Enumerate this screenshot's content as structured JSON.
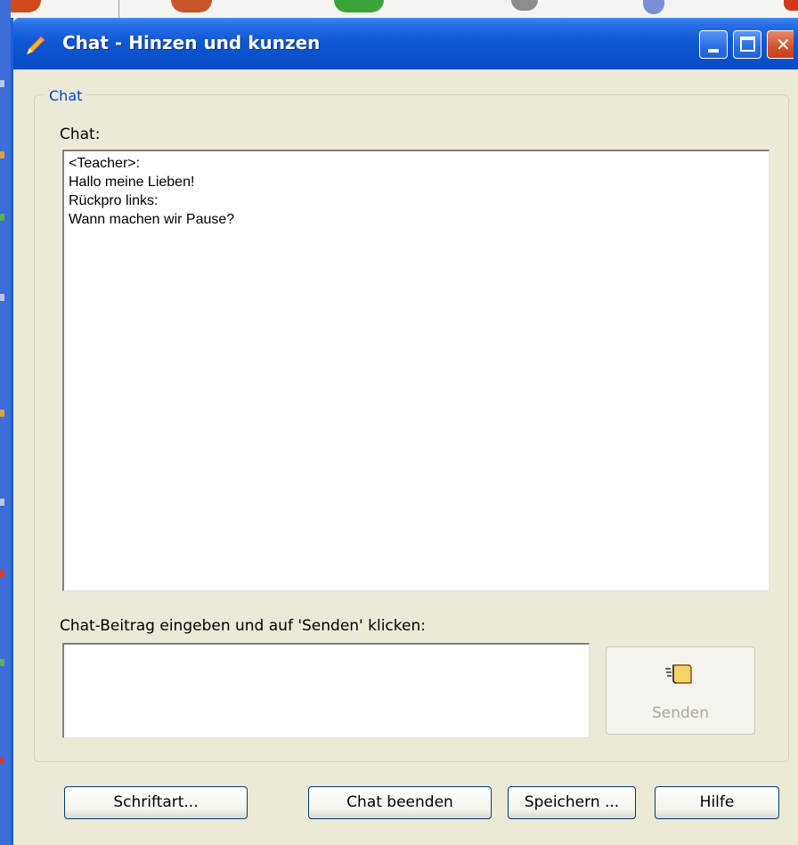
{
  "window": {
    "title": "Chat - Hinzen und kunzen"
  },
  "group": {
    "legend": "Chat"
  },
  "chat_log": {
    "label": "Chat:",
    "lines": [
      "<Teacher>:",
      "Hallo meine Lieben!",
      "Rückpro links:",
      "Wann machen wir Pause?"
    ]
  },
  "compose": {
    "label": "Chat-Beitrag eingeben und auf 'Senden' klicken:",
    "value": "",
    "send_label": "Senden"
  },
  "buttons": {
    "font": "Schriftart...",
    "end_chat": "Chat beenden",
    "save": "Speichern ...",
    "help": "Hilfe"
  },
  "colors": {
    "titlebar": "#0a4fcb",
    "group_legend": "#0046d5",
    "window_bg": "#ece9d8"
  },
  "icons": {
    "title": "pencil-icon",
    "send": "notepad-send-icon"
  }
}
